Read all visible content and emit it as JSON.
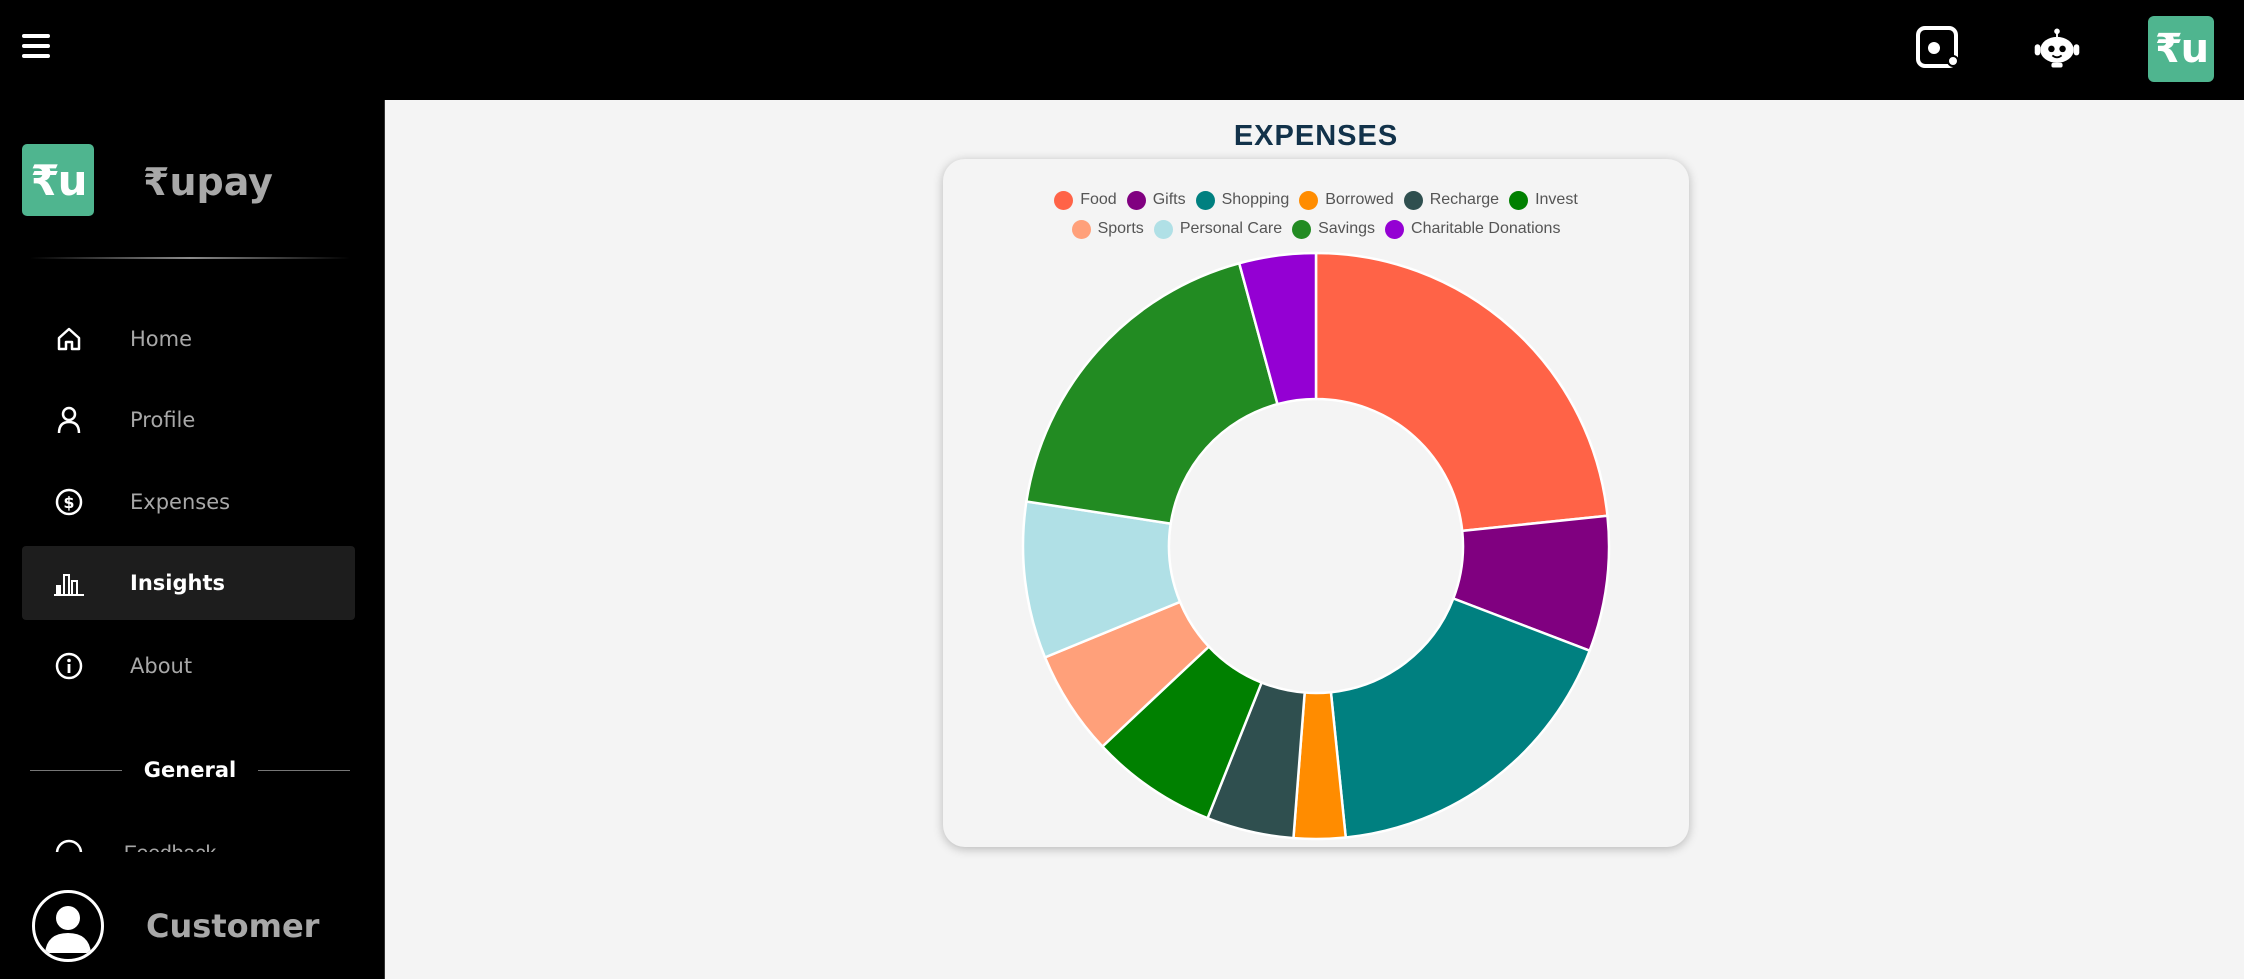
{
  "app": {
    "name": "₹upay",
    "logo_text": "₹u"
  },
  "topbar": {
    "menu_icon": "hamburger-menu-icon",
    "scan_icon": "scan-icon",
    "bot_icon": "chatbot-icon"
  },
  "sidebar": {
    "items": [
      {
        "label": "Home",
        "icon": "home-icon"
      },
      {
        "label": "Profile",
        "icon": "profile-icon"
      },
      {
        "label": "Expenses",
        "icon": "dollar-circle-icon"
      },
      {
        "label": "Insights",
        "icon": "bar-chart-icon",
        "active": true
      },
      {
        "label": "About",
        "icon": "info-icon"
      }
    ],
    "section_label": "General",
    "cut_item_label": "Feedback"
  },
  "user": {
    "name": "Customer"
  },
  "main": {
    "title": "EXPENSES"
  },
  "chart_data": {
    "type": "pie",
    "title": "EXPENSES",
    "legend_position": "top",
    "categories": [
      "Food",
      "Gifts",
      "Shopping",
      "Borrowed",
      "Recharge",
      "Invest",
      "Sports",
      "Personal Care",
      "Savings",
      "Charitable Donations"
    ],
    "values": [
      23.8,
      7.6,
      17.9,
      2.9,
      4.9,
      7.1,
      5.9,
      8.8,
      18.7,
      4.3
    ],
    "colors": [
      "#ff6347",
      "#800080",
      "#008080",
      "#ff8c00",
      "#2f4f4f",
      "#008000",
      "#ffa07a",
      "#b0e0e6",
      "#228b22",
      "#9400d3"
    ]
  }
}
